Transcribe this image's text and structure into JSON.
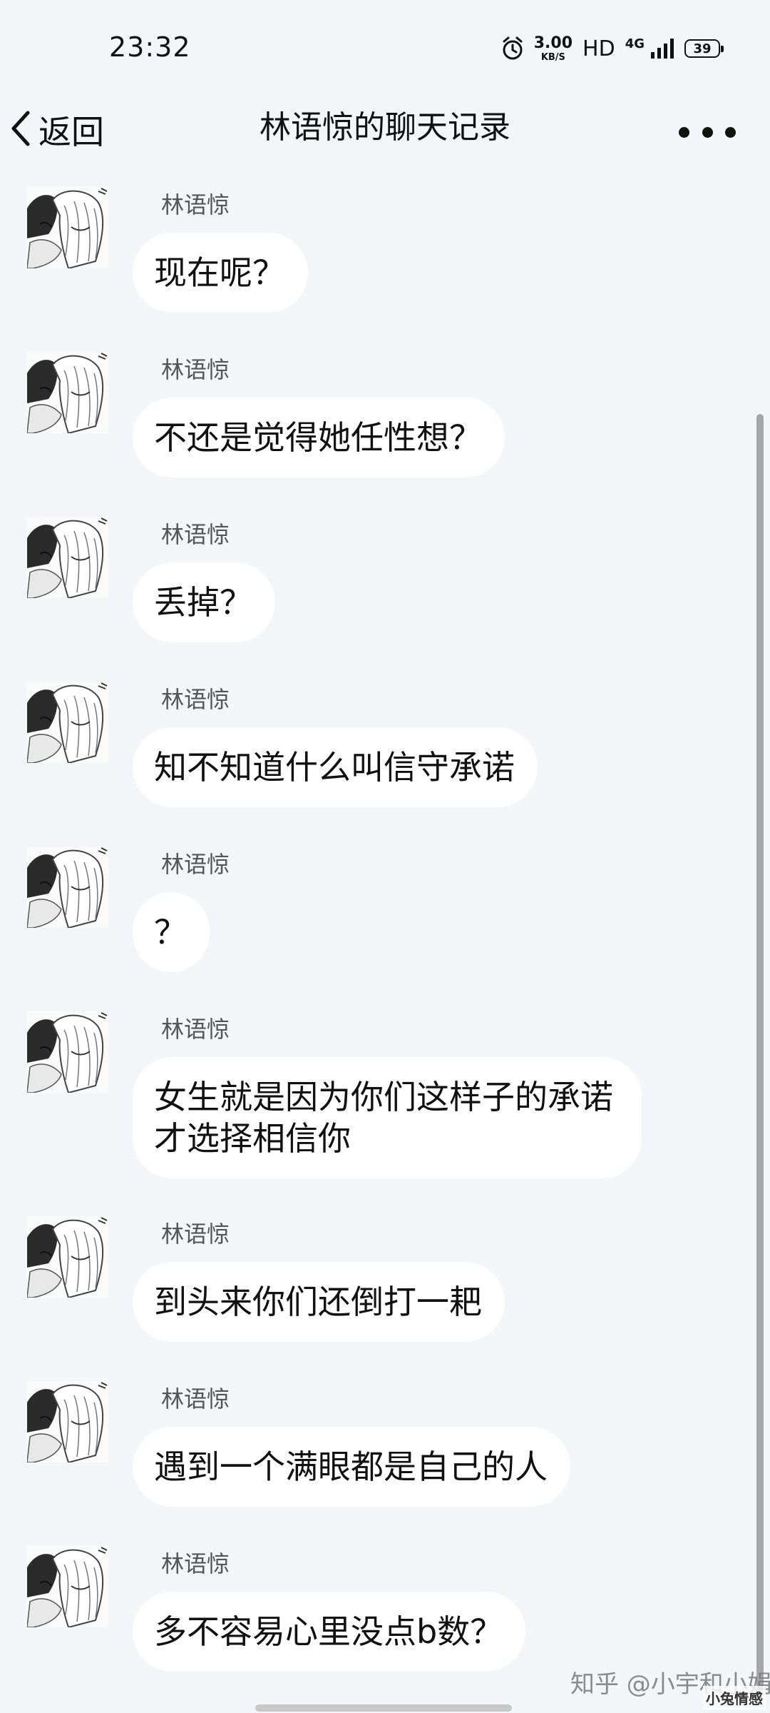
{
  "status_bar": {
    "time": "23:32",
    "speed_value": "3.00",
    "speed_unit": "KB/S",
    "hd_label": "HD",
    "network_type": "4G",
    "battery_level": "39",
    "icons": [
      "alarm-icon",
      "signal-icon",
      "battery-icon"
    ]
  },
  "nav": {
    "back_label": "返回",
    "title": "林语惊的聊天记录",
    "more_icon": "more-dots-icon"
  },
  "messages": [
    {
      "sender": "林语惊",
      "text": "现在呢？"
    },
    {
      "sender": "林语惊",
      "text": "不还是觉得她任性想？"
    },
    {
      "sender": "林语惊",
      "text": "丢掉？"
    },
    {
      "sender": "林语惊",
      "text": "知不知道什么叫信守承诺"
    },
    {
      "sender": "林语惊",
      "text": "？"
    },
    {
      "sender": "林语惊",
      "text": "女生就是因为你们这样子的承诺才选择相信你"
    },
    {
      "sender": "林语惊",
      "text": "到头来你们还倒打一耙"
    },
    {
      "sender": "林语惊",
      "text": "遇到一个满眼都是自己的人"
    },
    {
      "sender": "林语惊",
      "text": "多不容易心里没点b数？"
    }
  ],
  "watermark": {
    "text": "知乎 @小宇和小娟",
    "logo_text": "小兔情感"
  },
  "colors": {
    "background": "#f4f5f9",
    "bubble": "#ffffff",
    "text": "#111111",
    "sender": "#555555"
  }
}
